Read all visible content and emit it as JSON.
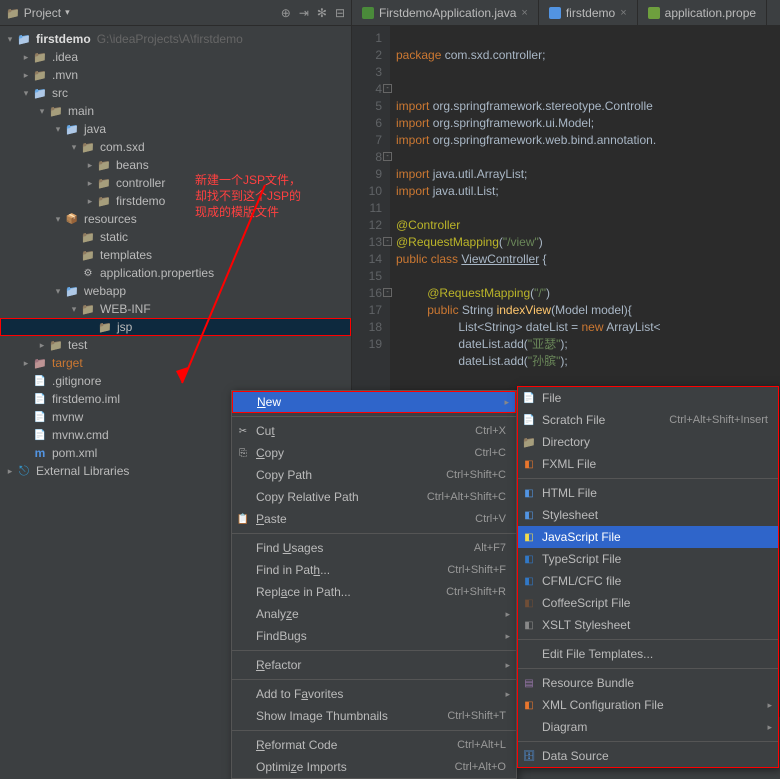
{
  "sidebar": {
    "title": "Project",
    "root": {
      "name": "firstdemo",
      "path": "G:\\ideaProjects\\A\\firstdemo"
    },
    "items": [
      ".idea",
      ".mvn",
      "src",
      "main",
      "java",
      "com.sxd",
      "beans",
      "controller",
      "firstdemo",
      "resources",
      "static",
      "templates",
      "application.properties",
      "webapp",
      "WEB-INF",
      "jsp",
      "test",
      "target",
      ".gitignore",
      "firstdemo.iml",
      "mvnw",
      "mvnw.cmd",
      "pom.xml",
      "External Libraries"
    ]
  },
  "tabs": [
    {
      "label": "FirstdemoApplication.java"
    },
    {
      "label": "firstdemo"
    },
    {
      "label": "application.prope"
    }
  ],
  "code": {
    "l1": "package com.sxd.controller;",
    "l4": "import org.springframework.stereotype.Controlle",
    "l5": "import org.springframework.ui.Model;",
    "l6": "import org.springframework.web.bind.annotation.",
    "l8": "import java.util.ArrayList;",
    "l9": "import java.util.List;",
    "l11": "@Controller",
    "l12a": "@RequestMapping",
    "l12b": "(\"/view\")",
    "l13a": "public class ",
    "l13b": "ViewController",
    "l13c": " {",
    "l15a": "@RequestMapping",
    "l15b": "(\"/\")",
    "l16a": "public ",
    "l16b": "String ",
    "l16c": "indexView",
    "l16d": "(Model model){",
    "l17a": "List<String> dateList = ",
    "l17b": "new ",
    "l17c": "ArrayList<",
    "l18a": "dateList.add(",
    "l18b": "\"亚瑟\"",
    "l18c": ");",
    "l19a": "dateList.add(",
    "l19b": "\"孙膑\"",
    "l19c": ");"
  },
  "annotation": {
    "line1": "新建一个JSP文件，",
    "line2": "却找不到这个JSP的",
    "line3": "现成的模版文件"
  },
  "ctx1": {
    "new": "New",
    "cut": "Cut",
    "cut_sc": "Ctrl+X",
    "copy": "Copy",
    "copy_sc": "Ctrl+C",
    "copypath": "Copy Path",
    "copypath_sc": "Ctrl+Shift+C",
    "copyrel": "Copy Relative Path",
    "copyrel_sc": "Ctrl+Alt+Shift+C",
    "paste": "Paste",
    "paste_sc": "Ctrl+V",
    "findu": "Find Usages",
    "findu_sc": "Alt+F7",
    "findp": "Find in Path...",
    "findp_sc": "Ctrl+Shift+F",
    "replp": "Replace in Path...",
    "replp_sc": "Ctrl+Shift+R",
    "analyze": "Analyze",
    "findbugs": "FindBugs",
    "refactor": "Refactor",
    "addfav": "Add to Favorites",
    "thumb": "Show Image Thumbnails",
    "thumb_sc": "Ctrl+Shift+T",
    "reformat": "Reformat Code",
    "reformat_sc": "Ctrl+Alt+L",
    "optimize": "Optimize Imports",
    "optimize_sc": "Ctrl+Alt+O"
  },
  "ctx2": {
    "file": "File",
    "scratch": "Scratch File",
    "scratch_sc": "Ctrl+Alt+Shift+Insert",
    "dir": "Directory",
    "fxml": "FXML File",
    "html": "HTML File",
    "css": "Stylesheet",
    "js": "JavaScript File",
    "ts": "TypeScript File",
    "cfml": "CFML/CFC file",
    "coffee": "CoffeeScript File",
    "xslt": "XSLT Stylesheet",
    "edittmpl": "Edit File Templates...",
    "rbundle": "Resource Bundle",
    "xmlconf": "XML Configuration File",
    "diagram": "Diagram",
    "datasrc": "Data Source"
  }
}
